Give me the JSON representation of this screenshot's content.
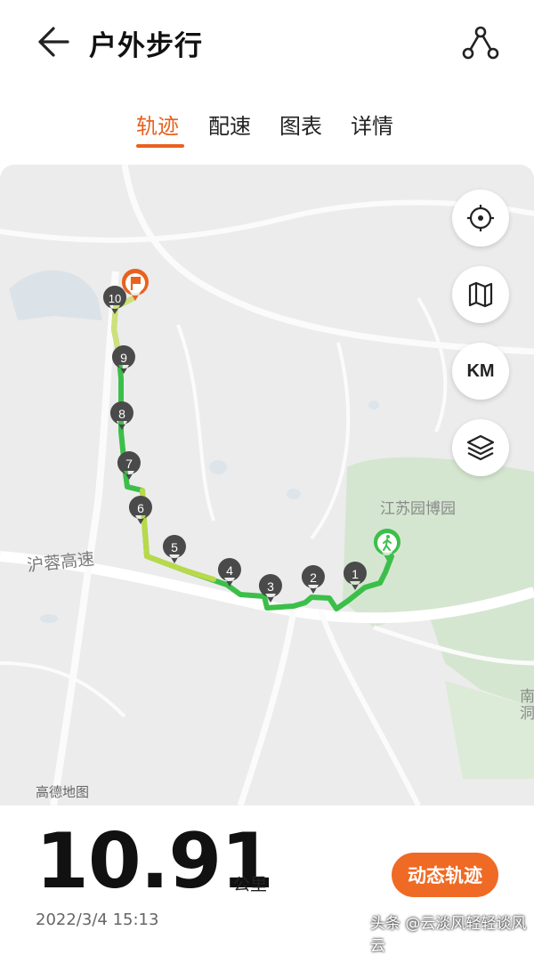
{
  "header": {
    "title": "户外步行",
    "back_icon": "arrow-left-icon",
    "share_icon": "share-nodes-icon"
  },
  "tabs": [
    {
      "label": "轨迹",
      "active": true
    },
    {
      "label": "配速",
      "active": false
    },
    {
      "label": "图表",
      "active": false
    },
    {
      "label": "详情",
      "active": false
    }
  ],
  "map": {
    "controls": {
      "locate_icon": "crosshair-icon",
      "map_icon": "folded-map-icon",
      "km_label": "KM",
      "layers_icon": "layers-icon"
    },
    "labels": {
      "park": "江苏园博园",
      "road": "沪蓉高速",
      "edge": "南洞",
      "attribution": "高德地图"
    },
    "km_markers": [
      "1",
      "2",
      "3",
      "4",
      "5",
      "6",
      "7",
      "8",
      "9",
      "10"
    ],
    "start_icon": "walking-person-icon",
    "end_icon": "flag-icon",
    "colors": {
      "route_green": "#3cbf4a",
      "route_yellow": "#b8d94a",
      "end_orange": "#e8621f",
      "marker_dark": "#4a4a4a"
    }
  },
  "summary": {
    "distance": "10.91",
    "unit": "公里",
    "date": "2022/3/4 15:13",
    "dynamic_button": "动态轨迹",
    "watermark": "头条 @云淡风轻轻谈风云"
  },
  "colors": {
    "accent": "#e8621f",
    "button": "#ef6a24"
  }
}
